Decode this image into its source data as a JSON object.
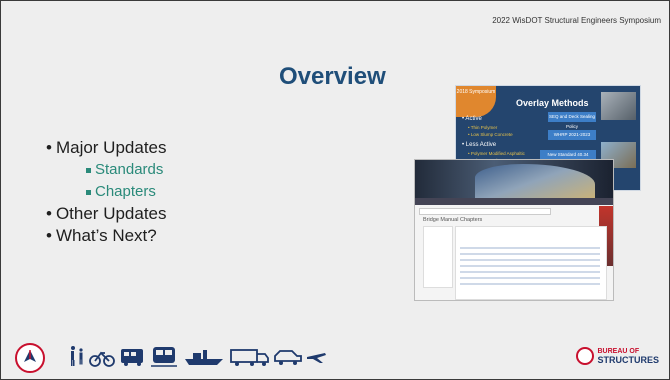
{
  "header": {
    "conference": "2022 WisDOT Structural Engineers Symposium"
  },
  "slide": {
    "title": "Overview",
    "bullets": [
      "Major Updates",
      "Other Updates",
      "What’s Next?"
    ],
    "sub_bullets": [
      "Standards",
      "Chapters"
    ]
  },
  "thumbnail_overlay": {
    "corner_label": "2018 Symposium",
    "title": "Overlay Methods",
    "active_label": "• Active",
    "active_items": [
      "• Thin Polymer",
      "• Low Slump Concrete"
    ],
    "less_active_label": "• Less Active",
    "less_active_items": [
      "• Polymer Modified Asphaltic",
      "• Polyester Polymer"
    ],
    "arrow_texts": [
      "SEQ and Deck Sealing Policy",
      "WHRP 2021-2023",
      "New Standard 40.34"
    ]
  },
  "thumbnail_manual": {
    "page_title": "Bridge Manual Chapters"
  },
  "footer": {
    "bureau_line1": "BUREAU OF",
    "bureau_line2": "STRUCTURES"
  },
  "colors": {
    "title": "#1f4e79",
    "sub_bullet": "#2a8a7a",
    "accent_red": "#c8102e",
    "navy": "#1f3a6d"
  }
}
